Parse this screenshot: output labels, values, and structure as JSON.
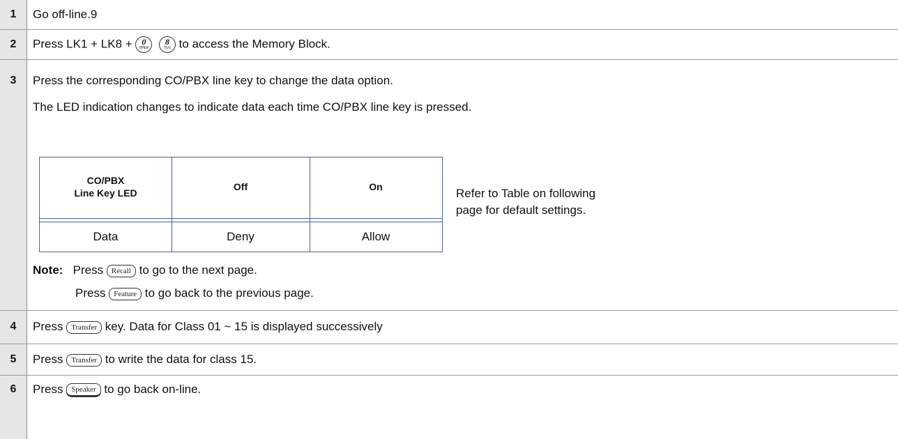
{
  "steps": [
    {
      "num": "1",
      "text": "Go off-line.9"
    },
    {
      "num": "2",
      "text_before": "Press LK1 + LK8 + ",
      "dial_keys": [
        {
          "digit": "0",
          "letters": "OPER"
        },
        {
          "digit": "8",
          "letters": "TUV"
        }
      ],
      "text_after": " to access the Memory Block."
    },
    {
      "num": "3",
      "line1": "Press the corresponding CO/PBX line key to change the data option.",
      "line2": "The LED indication changes to indicate data each time CO/PBX line key is pressed.",
      "table": {
        "headers": [
          "CO/PBX\nLine Key LED",
          "Off",
          "On"
        ],
        "header_line1": "CO/PBX",
        "header_line2": "Line Key LED",
        "rows": [
          [
            "Data",
            "Deny",
            "Allow"
          ]
        ]
      },
      "side_note": "Refer to Table on following page for default settings.",
      "side_note_line1": "Refer to Table on following",
      "side_note_line2": "page for default settings.",
      "note_label": "Note:",
      "note1_before": "Press ",
      "note1_key": "Recall",
      "note1_after": " to go to the next page.",
      "note2_before": "Press ",
      "note2_key": "Feature",
      "note2_after": " to go back to the previous page."
    },
    {
      "num": "4",
      "text_before": "Press ",
      "key": "Transfer",
      "text_after": " key. Data for Class 01 ~ 15 is displayed successively"
    },
    {
      "num": "5",
      "text_before": "Press ",
      "key": "Transfer",
      "text_after": " to write the data for class 15."
    },
    {
      "num": "6",
      "text_before": "Press ",
      "key": "Speaker",
      "text_after": " to go back on-line."
    }
  ]
}
